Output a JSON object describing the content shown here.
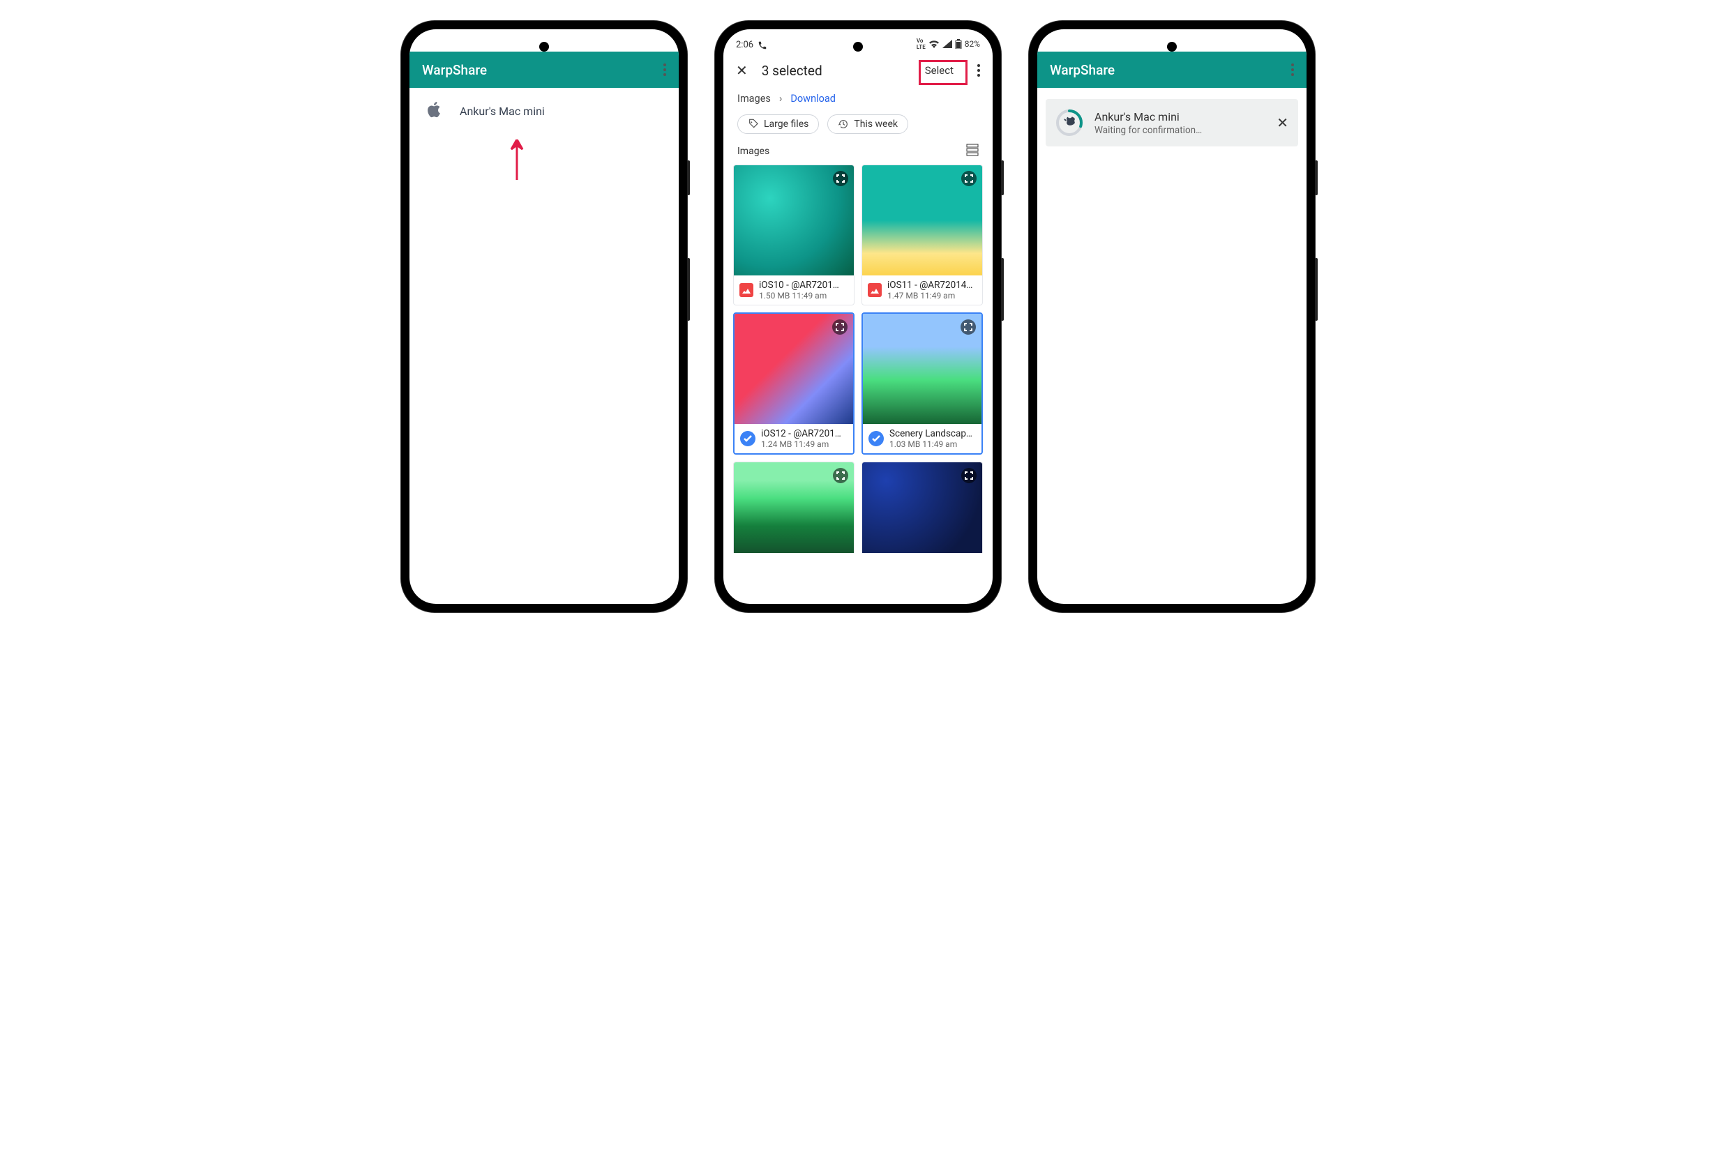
{
  "screen1": {
    "app_title": "WarpShare",
    "device_name": "Ankur's Mac mini"
  },
  "screen2": {
    "status": {
      "time": "2:06",
      "battery": "82%"
    },
    "header": {
      "title": "3 selected",
      "select_label": "Select"
    },
    "breadcrumb": {
      "root": "Images",
      "current": "Download"
    },
    "chips": {
      "large_files": "Large files",
      "this_week": "This week"
    },
    "section_label": "Images",
    "thumbs": [
      {
        "name": "iOS10 - @AR7201…",
        "sub": "1.50 MB 11:49 am"
      },
      {
        "name": "iOS11 - @AR72014…",
        "sub": "1.47 MB 11:49 am"
      },
      {
        "name": "iOS12 - @AR7201…",
        "sub": "1.24 MB 11:49 am"
      },
      {
        "name": "Scenery Landscap…",
        "sub": "1.03 MB 11:49 am"
      }
    ]
  },
  "screen3": {
    "app_title": "WarpShare",
    "transfer": {
      "device": "Ankur's Mac mini",
      "status": "Waiting for confirmation…"
    }
  },
  "colors": {
    "brand": "#0d9488",
    "highlight": "#e11d48",
    "link": "#2563eb",
    "selected": "#3b82f6"
  }
}
